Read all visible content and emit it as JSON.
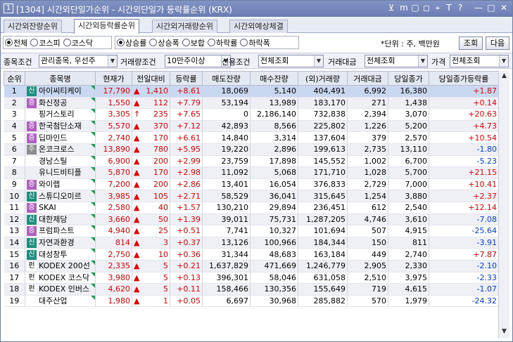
{
  "window": {
    "number": "1",
    "title": "[1304] 시간외단일가순위 - 시간외단일가 등락률순위 (KRX)",
    "controls": [
      "⊻",
      "m",
      "▢",
      "◻",
      "⌖",
      "T",
      "?",
      "—",
      "□",
      "✕"
    ]
  },
  "tabs": [
    {
      "label": "시간외잔량순위",
      "active": false
    },
    {
      "label": "시간외등락률순위",
      "active": true
    },
    {
      "label": "시간외거래량순위",
      "active": false
    },
    {
      "label": "시간외예상체결",
      "active": false
    }
  ],
  "market_radios": [
    {
      "label": "전체",
      "checked": true
    },
    {
      "label": "코스피",
      "checked": false
    },
    {
      "label": "코스닥",
      "checked": false
    }
  ],
  "sort_radios": [
    {
      "label": "상승률",
      "checked": true
    },
    {
      "label": "상승폭",
      "checked": false
    },
    {
      "label": "보합",
      "checked": false
    },
    {
      "label": "하락률",
      "checked": false
    },
    {
      "label": "하락폭",
      "checked": false
    }
  ],
  "unit_text": "*단위 : 주, 백만원",
  "buttons": {
    "query": "조회",
    "next": "다음"
  },
  "filters": {
    "stock_cond_label": "종목조건",
    "stock_cond_value": "관리종목, 우선주",
    "volume_cond_label": "거래량조건",
    "volume_cond_value": "10만주이상",
    "credit_cond_label": "신용조건",
    "credit_cond_value": "전체조회",
    "amount_label": "거래대금",
    "amount_value": "전체조회",
    "price_label": "가격",
    "price_value": "전체조회"
  },
  "columns": [
    "순위",
    "종목명",
    "현재가",
    "전일대비",
    "등락률",
    "매도잔량",
    "매수잔량",
    "(외)거래량",
    "거래대금",
    "당일종가",
    "당일종가등락률"
  ],
  "rows": [
    {
      "rank": "1",
      "badge": "신",
      "badge_type": "sin",
      "name": "아이씨티케이",
      "price": "17,790",
      "dir": "up",
      "change": "1,410",
      "rate": "+8.61",
      "ask": "18,069",
      "bid": "5,140",
      "volume": "404,491",
      "amount": "6,992",
      "close": "16,380",
      "close_rate": "+1.87",
      "close_dir": "up"
    },
    {
      "rank": "2",
      "badge": "증",
      "badge_type": "ju",
      "name": "화신정공",
      "price": "1,550",
      "dir": "up",
      "change": "112",
      "rate": "+7.79",
      "ask": "53,194",
      "bid": "13,989",
      "volume": "183,170",
      "amount": "271",
      "close": "1,438",
      "close_rate": "+0.14",
      "close_dir": "up"
    },
    {
      "rank": "3",
      "badge": "",
      "badge_type": "",
      "name": "핑거스토리",
      "price": "3,305",
      "dir": "limit",
      "change": "235",
      "rate": "+7.65",
      "ask": "0",
      "bid": "2,186,140",
      "volume": "732,838",
      "amount": "2,394",
      "close": "3,070",
      "close_rate": "+20.63",
      "close_dir": "up"
    },
    {
      "rank": "4",
      "badge": "증",
      "badge_type": "ju",
      "name": "한국첨단소재",
      "price": "5,570",
      "dir": "up",
      "change": "370",
      "rate": "+7.12",
      "ask": "42,893",
      "bid": "8,566",
      "volume": "225,802",
      "amount": "1,226",
      "close": "5,200",
      "close_rate": "+4.73",
      "close_dir": "up"
    },
    {
      "rank": "5",
      "badge": "증",
      "badge_type": "ju",
      "name": "딥마인드",
      "price": "2,740",
      "dir": "up",
      "change": "170",
      "rate": "+6.61",
      "ask": "14,840",
      "bid": "3,314",
      "volume": "137,604",
      "amount": "379",
      "close": "2,570",
      "close_rate": "+10.54",
      "close_dir": "up"
    },
    {
      "rank": "6",
      "badge": "주",
      "badge_type": "gu",
      "name": "온코크로스",
      "price": "13,890",
      "dir": "up",
      "change": "780",
      "rate": "+5.95",
      "ask": "19,220",
      "bid": "2,896",
      "volume": "199,613",
      "amount": "2,735",
      "close": "13,110",
      "close_rate": "-1.80",
      "close_dir": "dn"
    },
    {
      "rank": "7",
      "badge": "",
      "badge_type": "",
      "name": "경남스틸",
      "price": "6,900",
      "dir": "up",
      "change": "200",
      "rate": "+2.99",
      "ask": "23,759",
      "bid": "17,898",
      "volume": "145,552",
      "amount": "1,002",
      "close": "6,700",
      "close_rate": "-5.23",
      "close_dir": "dn"
    },
    {
      "rank": "8",
      "badge": "",
      "badge_type": "",
      "name": "유니드비티플",
      "price": "5,870",
      "dir": "up",
      "change": "170",
      "rate": "+2.98",
      "ask": "11,092",
      "bid": "5,068",
      "volume": "171,710",
      "amount": "1,028",
      "close": "5,700",
      "close_rate": "+21.15",
      "close_dir": "up"
    },
    {
      "rank": "9",
      "badge": "증",
      "badge_type": "ju",
      "name": "와이랩",
      "price": "7,200",
      "dir": "up",
      "change": "200",
      "rate": "+2.86",
      "ask": "13,401",
      "bid": "16,054",
      "volume": "376,833",
      "amount": "2,729",
      "close": "7,000",
      "close_rate": "+10.41",
      "close_dir": "up"
    },
    {
      "rank": "10",
      "badge": "신",
      "badge_type": "sin",
      "name": "스튜디오미르",
      "price": "3,985",
      "dir": "up",
      "change": "105",
      "rate": "+2.71",
      "ask": "58,529",
      "bid": "36,041",
      "volume": "315,645",
      "amount": "1,254",
      "close": "3,880",
      "close_rate": "+2.37",
      "close_dir": "up"
    },
    {
      "rank": "11",
      "badge": "증",
      "badge_type": "ju",
      "name": "SKAI",
      "price": "2,580",
      "dir": "up",
      "change": "40",
      "rate": "+1.57",
      "ask": "130,210",
      "bid": "29,894",
      "volume": "236,451",
      "amount": "612",
      "close": "2,540",
      "close_rate": "+12.14",
      "close_dir": "up"
    },
    {
      "rank": "12",
      "badge": "신",
      "badge_type": "sin",
      "name": "대한제당",
      "price": "3,660",
      "dir": "up",
      "change": "50",
      "rate": "+1.39",
      "ask": "39,011",
      "bid": "75,731",
      "volume": "1,287,205",
      "amount": "4,746",
      "close": "3,610",
      "close_rate": "-7.08",
      "close_dir": "dn"
    },
    {
      "rank": "13",
      "badge": "증",
      "badge_type": "ju",
      "name": "프럼파스트",
      "price": "4,940",
      "dir": "up",
      "change": "25",
      "rate": "+0.51",
      "ask": "7,741",
      "bid": "10,327",
      "volume": "101,694",
      "amount": "507",
      "close": "4,915",
      "close_rate": "-25.64",
      "close_dir": "dn"
    },
    {
      "rank": "14",
      "badge": "신",
      "badge_type": "sin",
      "name": "자연과환경",
      "price": "814",
      "dir": "up",
      "change": "3",
      "rate": "+0.37",
      "ask": "13,126",
      "bid": "100,966",
      "volume": "184,344",
      "amount": "150",
      "close": "811",
      "close_rate": "-3.91",
      "close_dir": "dn"
    },
    {
      "rank": "15",
      "badge": "신",
      "badge_type": "sin",
      "name": "대성창투",
      "price": "2,750",
      "dir": "up",
      "change": "10",
      "rate": "+0.36",
      "ask": "31,344",
      "bid": "48,683",
      "volume": "163,184",
      "amount": "449",
      "close": "2,740",
      "close_rate": "+7.87",
      "close_dir": "up"
    },
    {
      "rank": "16",
      "badge": "펀",
      "badge_type": "pyeon",
      "name": "KODEX 200선",
      "price": "2,335",
      "dir": "up",
      "change": "5",
      "rate": "+0.21",
      "ask": "1,637,829",
      "bid": "471,669",
      "volume": "1,246,779",
      "amount": "2,905",
      "close": "2,330",
      "close_rate": "-2.10",
      "close_dir": "dn"
    },
    {
      "rank": "17",
      "badge": "펀",
      "badge_type": "pyeon",
      "name": "KODEX 코스닥",
      "price": "3,980",
      "dir": "up",
      "change": "5",
      "rate": "+0.13",
      "ask": "396,301",
      "bid": "58,046",
      "volume": "631,058",
      "amount": "2,510",
      "close": "3,975",
      "close_rate": "-2.33",
      "close_dir": "dn"
    },
    {
      "rank": "18",
      "badge": "펀",
      "badge_type": "pyeon",
      "name": "KODEX 인버스",
      "price": "4,620",
      "dir": "up",
      "change": "5",
      "rate": "+0.11",
      "ask": "158,466",
      "bid": "130,356",
      "volume": "155,649",
      "amount": "719",
      "close": "4,615",
      "close_rate": "-1.07",
      "close_dir": "dn"
    },
    {
      "rank": "19",
      "badge": "",
      "badge_type": "",
      "name": "대주산업",
      "price": "1,980",
      "dir": "up",
      "change": "1",
      "rate": "+0.05",
      "ask": "6,697",
      "bid": "30,968",
      "volume": "285,882",
      "amount": "570",
      "close": "1,979",
      "close_rate": "-24.32",
      "close_dir": "dn"
    }
  ],
  "colors": {
    "up": "#e00000",
    "down": "#0040d0",
    "title_bar": "#7385bb",
    "selected_row": "#c9d8f0"
  }
}
